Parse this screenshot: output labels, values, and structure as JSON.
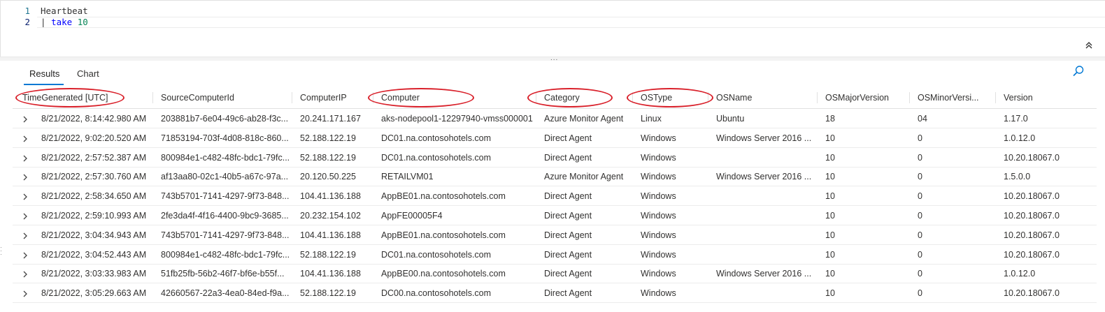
{
  "editor": {
    "lines": [
      {
        "number": "1",
        "text": "Heartbeat"
      },
      {
        "number": "2",
        "pipe": "|",
        "keyword": "take",
        "value": "10"
      }
    ]
  },
  "splitter_glyph": "...",
  "tabs": [
    {
      "label": "Results",
      "selected": true
    },
    {
      "label": "Chart",
      "selected": false
    }
  ],
  "icons": {
    "collapse": "double-chevron-up-icon",
    "search": "search-icon",
    "expand": "chevron-right-icon"
  },
  "colors": {
    "accent": "#0078d4",
    "annotation": "#d9202a"
  },
  "columns": [
    "TimeGenerated [UTC]",
    "SourceComputerId",
    "ComputerIP",
    "Computer",
    "Category",
    "OSType",
    "OSName",
    "OSMajorVersion",
    "OSMinorVersi...",
    "Version"
  ],
  "highlighted_columns": [
    "TimeGenerated [UTC]",
    "Computer",
    "Category",
    "OSType"
  ],
  "rows": [
    [
      "8/21/2022, 8:14:42.980 AM",
      "203881b7-6e04-49c6-ab28-f3c...",
      "20.241.171.167",
      "aks-nodepool1-12297940-vmss000001",
      "Azure Monitor Agent",
      "Linux",
      "Ubuntu",
      "18",
      "04",
      "1.17.0"
    ],
    [
      "8/21/2022, 9:02:20.520 AM",
      "71853194-703f-4d08-818c-860...",
      "52.188.122.19",
      "DC01.na.contosohotels.com",
      "Direct Agent",
      "Windows",
      "Windows Server 2016 ...",
      "10",
      "0",
      "1.0.12.0"
    ],
    [
      "8/21/2022, 2:57:52.387 AM",
      "800984e1-c482-48fc-bdc1-79fc...",
      "52.188.122.19",
      "DC01.na.contosohotels.com",
      "Direct Agent",
      "Windows",
      "",
      "10",
      "0",
      "10.20.18067.0"
    ],
    [
      "8/21/2022, 2:57:30.760 AM",
      "af13aa80-02c1-40b5-a67c-97a...",
      "20.120.50.225",
      "RETAILVM01",
      "Azure Monitor Agent",
      "Windows",
      "Windows Server 2016 ...",
      "10",
      "0",
      "1.5.0.0"
    ],
    [
      "8/21/2022, 2:58:34.650 AM",
      "743b5701-7141-4297-9f73-848...",
      "104.41.136.188",
      "AppBE01.na.contosohotels.com",
      "Direct Agent",
      "Windows",
      "",
      "10",
      "0",
      "10.20.18067.0"
    ],
    [
      "8/21/2022, 2:59:10.993 AM",
      "2fe3da4f-4f16-4400-9bc9-3685...",
      "20.232.154.102",
      "AppFE00005F4",
      "Direct Agent",
      "Windows",
      "",
      "10",
      "0",
      "10.20.18067.0"
    ],
    [
      "8/21/2022, 3:04:34.943 AM",
      "743b5701-7141-4297-9f73-848...",
      "104.41.136.188",
      "AppBE01.na.contosohotels.com",
      "Direct Agent",
      "Windows",
      "",
      "10",
      "0",
      "10.20.18067.0"
    ],
    [
      "8/21/2022, 3:04:52.443 AM",
      "800984e1-c482-48fc-bdc1-79fc...",
      "52.188.122.19",
      "DC01.na.contosohotels.com",
      "Direct Agent",
      "Windows",
      "",
      "10",
      "0",
      "10.20.18067.0"
    ],
    [
      "8/21/2022, 3:03:33.983 AM",
      "51fb25fb-56b2-46f7-bf6e-b55f...",
      "104.41.136.188",
      "AppBE00.na.contosohotels.com",
      "Direct Agent",
      "Windows",
      "Windows Server 2016 ...",
      "10",
      "0",
      "1.0.12.0"
    ],
    [
      "8/21/2022, 3:05:29.663 AM",
      "42660567-22a3-4ea0-84ed-f9a...",
      "52.188.122.19",
      "DC00.na.contosohotels.com",
      "Direct Agent",
      "Windows",
      "",
      "10",
      "0",
      "10.20.18067.0"
    ]
  ]
}
